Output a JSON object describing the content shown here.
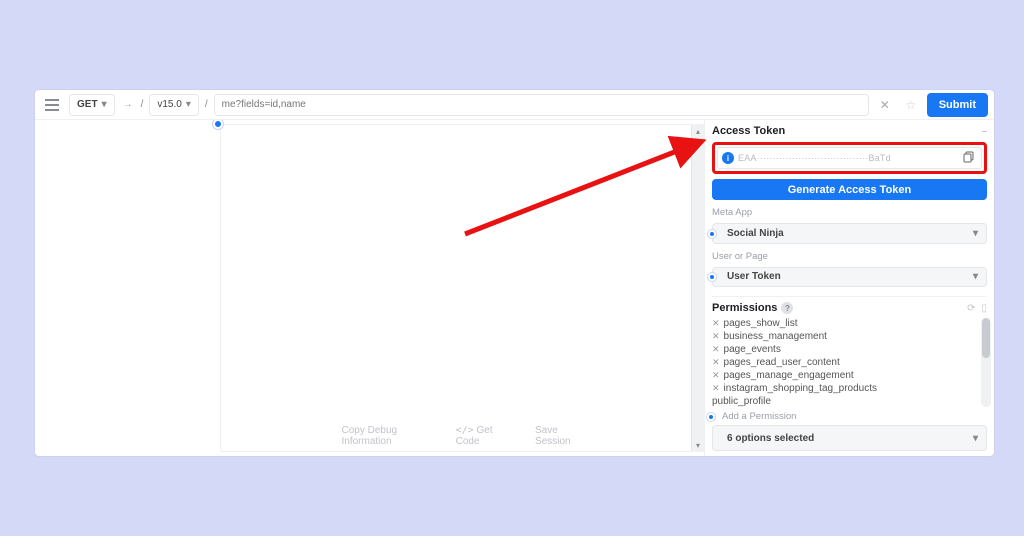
{
  "toolbar": {
    "method": "GET",
    "version": "v15.0",
    "path": "me?fields=id,name",
    "submit": "Submit"
  },
  "results": {
    "footer_copy": "Copy Debug Information",
    "footer_code": "Get Code",
    "footer_save": "Save Session"
  },
  "right": {
    "access_token_title": "Access Token",
    "token_value": "EAA···································BaTd",
    "generate_label": "Generate Access Token",
    "meta_app_label": "Meta App",
    "meta_app_value": "Social Ninja",
    "user_or_page_label": "User or Page",
    "user_or_page_value": "User Token",
    "permissions_title": "Permissions",
    "add_permission_label": "Add a Permission",
    "selected_count": "6 options selected",
    "permissions": [
      "pages_show_list",
      "business_management",
      "page_events",
      "pages_read_user_content",
      "pages_manage_engagement",
      "instagram_shopping_tag_products",
      "public_profile"
    ]
  },
  "icons": {
    "info": "i",
    "help": "?",
    "chevron": "▾",
    "caret_up": "▴",
    "caret_dn": "▾",
    "close": "✕"
  }
}
